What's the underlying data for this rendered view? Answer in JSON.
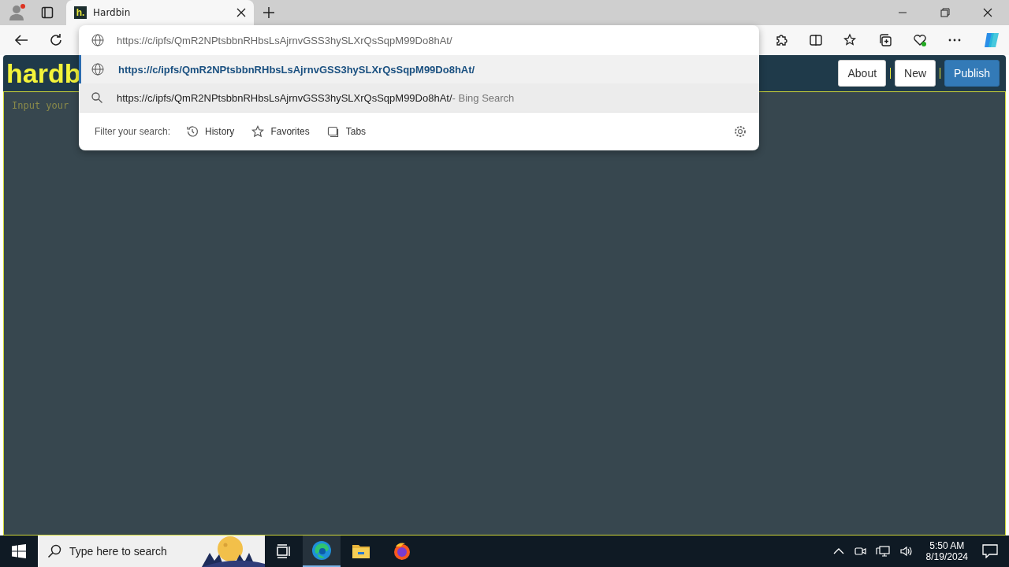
{
  "browser": {
    "tabs": [
      {
        "title": "Hardbin",
        "favicon": "h.",
        "selected": true
      }
    ],
    "address": {
      "value": "https://c/ipfs/QmR2NPtsbbnRHbsLsAjrnvGSS3hySLXrQsSqpM99Do8hAt/"
    },
    "suggestions": [
      {
        "kind": "url",
        "text": "https://c/ipfs/QmR2NPtsbbnRHbsLsAjrnvGSS3hySLXrQsSqpM99Do8hAt/",
        "selected": true
      },
      {
        "kind": "search",
        "text": "https://c/ipfs/QmR2NPtsbbnRHbsLsAjrnvGSS3hySLXrQsSqpM99Do8hAt/",
        "suffix": "- Bing Search",
        "selected": false
      }
    ],
    "filter": {
      "label": "Filter your search:",
      "options": [
        {
          "kind": "history",
          "label": "History"
        },
        {
          "kind": "favorites",
          "label": "Favorites"
        },
        {
          "kind": "tabs",
          "label": "Tabs"
        }
      ]
    }
  },
  "page": {
    "logo": "hardb",
    "editor_placeholder": "Input your",
    "buttons": [
      {
        "label": "About",
        "primary": false
      },
      {
        "label": "New",
        "primary": false
      },
      {
        "label": "Publish",
        "primary": true
      }
    ]
  },
  "taskbar": {
    "search_placeholder": "Type here to search",
    "time": "5:50 AM",
    "date": "8/19/2024"
  }
}
